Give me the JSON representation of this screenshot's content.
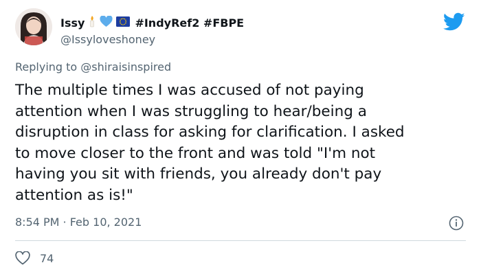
{
  "author": {
    "display_name": "Issy",
    "emoji_icons": [
      "candle-icon",
      "blue-heart-icon",
      "eu-flag-icon"
    ],
    "hashtags": "#IndyRef2 #FBPE",
    "handle": "@Issyloveshoney"
  },
  "reply": {
    "prefix": "Replying to",
    "target": "@shiraisinspired"
  },
  "tweet": {
    "lines": [
      "The multiple times I was accused of not paying",
      "attention when I was struggling to hear/being a",
      "disruption in class for asking for clarification. I asked",
      "to move closer to the front and was told \"I'm not",
      "having you sit with friends, you already don't pay",
      "attention as is!\""
    ]
  },
  "meta": {
    "timestamp": "8:54 PM · Feb 10, 2021"
  },
  "engagement": {
    "likes": "74"
  },
  "colors": {
    "twitter_blue": "#1d9bf0",
    "secondary_text": "#536471",
    "primary_text": "#0f1419",
    "divider": "#cfd9de"
  }
}
